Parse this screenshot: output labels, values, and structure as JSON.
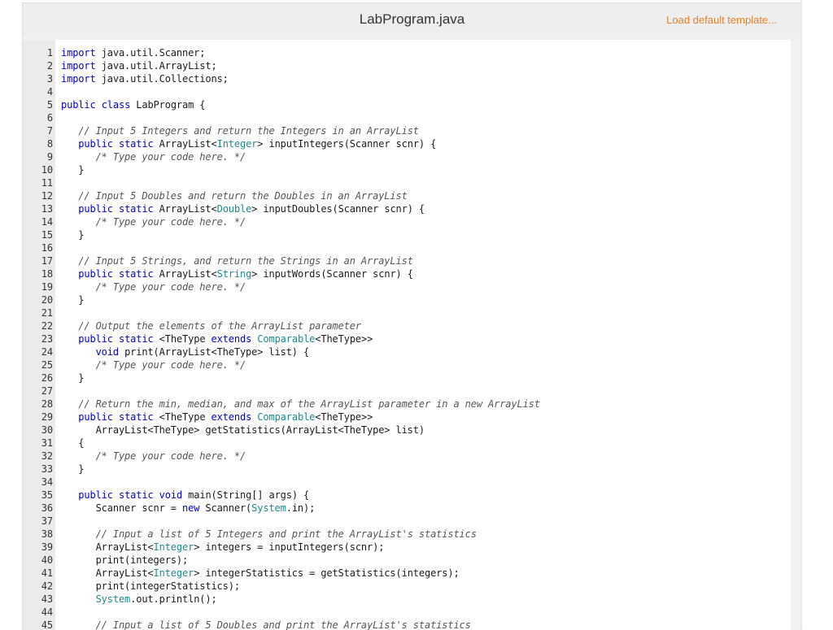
{
  "header": {
    "file_name": "LabProgram.java",
    "load_default_label": "Load default template..."
  },
  "editor": {
    "lines": [
      {
        "num": "1",
        "tokens": [
          {
            "t": "kw",
            "v": "import"
          },
          {
            "t": "",
            "v": " java.util.Scanner;"
          }
        ]
      },
      {
        "num": "2",
        "tokens": [
          {
            "t": "kw",
            "v": "import"
          },
          {
            "t": "",
            "v": " java.util.ArrayList;"
          }
        ]
      },
      {
        "num": "3",
        "tokens": [
          {
            "t": "kw",
            "v": "import"
          },
          {
            "t": "",
            "v": " java.util.Collections;"
          }
        ]
      },
      {
        "num": "4",
        "tokens": []
      },
      {
        "num": "5",
        "tokens": [
          {
            "t": "kw",
            "v": "public"
          },
          {
            "t": "",
            "v": " "
          },
          {
            "t": "kw",
            "v": "class"
          },
          {
            "t": "",
            "v": " LabProgram {"
          }
        ]
      },
      {
        "num": "6",
        "tokens": []
      },
      {
        "num": "7",
        "tokens": [
          {
            "t": "",
            "v": "   "
          },
          {
            "t": "cm",
            "v": "// Input 5 Integers and return the Integers in an ArrayList"
          }
        ]
      },
      {
        "num": "8",
        "tokens": [
          {
            "t": "",
            "v": "   "
          },
          {
            "t": "kw",
            "v": "public"
          },
          {
            "t": "",
            "v": " "
          },
          {
            "t": "kw",
            "v": "static"
          },
          {
            "t": "",
            "v": " ArrayList<"
          },
          {
            "t": "ty",
            "v": "Integer"
          },
          {
            "t": "",
            "v": "> inputIntegers(Scanner scnr) {"
          }
        ]
      },
      {
        "num": "9",
        "tokens": [
          {
            "t": "",
            "v": "      "
          },
          {
            "t": "cm",
            "v": "/* Type your code here. */"
          }
        ]
      },
      {
        "num": "10",
        "tokens": [
          {
            "t": "",
            "v": "   }"
          }
        ]
      },
      {
        "num": "11",
        "tokens": []
      },
      {
        "num": "12",
        "tokens": [
          {
            "t": "",
            "v": "   "
          },
          {
            "t": "cm",
            "v": "// Input 5 Doubles and return the Doubles in an ArrayList"
          }
        ]
      },
      {
        "num": "13",
        "tokens": [
          {
            "t": "",
            "v": "   "
          },
          {
            "t": "kw",
            "v": "public"
          },
          {
            "t": "",
            "v": " "
          },
          {
            "t": "kw",
            "v": "static"
          },
          {
            "t": "",
            "v": " ArrayList<"
          },
          {
            "t": "ty",
            "v": "Double"
          },
          {
            "t": "",
            "v": "> inputDoubles(Scanner scnr) {"
          }
        ]
      },
      {
        "num": "14",
        "tokens": [
          {
            "t": "",
            "v": "      "
          },
          {
            "t": "cm",
            "v": "/* Type your code here. */"
          }
        ]
      },
      {
        "num": "15",
        "tokens": [
          {
            "t": "",
            "v": "   }"
          }
        ]
      },
      {
        "num": "16",
        "tokens": []
      },
      {
        "num": "17",
        "tokens": [
          {
            "t": "",
            "v": "   "
          },
          {
            "t": "cm",
            "v": "// Input 5 Strings, and return the Strings in an ArrayList"
          }
        ]
      },
      {
        "num": "18",
        "tokens": [
          {
            "t": "",
            "v": "   "
          },
          {
            "t": "kw",
            "v": "public"
          },
          {
            "t": "",
            "v": " "
          },
          {
            "t": "kw",
            "v": "static"
          },
          {
            "t": "",
            "v": " ArrayList<"
          },
          {
            "t": "ty",
            "v": "String"
          },
          {
            "t": "",
            "v": "> inputWords(Scanner scnr) {"
          }
        ]
      },
      {
        "num": "19",
        "tokens": [
          {
            "t": "",
            "v": "      "
          },
          {
            "t": "cm",
            "v": "/* Type your code here. */"
          }
        ]
      },
      {
        "num": "20",
        "tokens": [
          {
            "t": "",
            "v": "   }"
          }
        ]
      },
      {
        "num": "21",
        "tokens": []
      },
      {
        "num": "22",
        "tokens": [
          {
            "t": "",
            "v": "   "
          },
          {
            "t": "cm",
            "v": "// Output the elements of the ArrayList parameter"
          }
        ]
      },
      {
        "num": "23",
        "tokens": [
          {
            "t": "",
            "v": "   "
          },
          {
            "t": "kw",
            "v": "public"
          },
          {
            "t": "",
            "v": " "
          },
          {
            "t": "kw",
            "v": "static"
          },
          {
            "t": "",
            "v": " <TheType "
          },
          {
            "t": "kw",
            "v": "extends"
          },
          {
            "t": "",
            "v": " "
          },
          {
            "t": "ty",
            "v": "Comparable"
          },
          {
            "t": "",
            "v": "<TheType>>"
          }
        ]
      },
      {
        "num": "24",
        "tokens": [
          {
            "t": "",
            "v": "      "
          },
          {
            "t": "kw",
            "v": "void"
          },
          {
            "t": "",
            "v": " print(ArrayList<TheType> list) {"
          }
        ]
      },
      {
        "num": "25",
        "tokens": [
          {
            "t": "",
            "v": "      "
          },
          {
            "t": "cm",
            "v": "/* Type your code here. */"
          }
        ]
      },
      {
        "num": "26",
        "tokens": [
          {
            "t": "",
            "v": "   }"
          }
        ]
      },
      {
        "num": "27",
        "tokens": []
      },
      {
        "num": "28",
        "tokens": [
          {
            "t": "",
            "v": "   "
          },
          {
            "t": "cm",
            "v": "// Return the min, median, and max of the ArrayList parameter in a new ArrayList"
          }
        ]
      },
      {
        "num": "29",
        "tokens": [
          {
            "t": "",
            "v": "   "
          },
          {
            "t": "kw",
            "v": "public"
          },
          {
            "t": "",
            "v": " "
          },
          {
            "t": "kw",
            "v": "static"
          },
          {
            "t": "",
            "v": " <TheType "
          },
          {
            "t": "kw",
            "v": "extends"
          },
          {
            "t": "",
            "v": " "
          },
          {
            "t": "ty",
            "v": "Comparable"
          },
          {
            "t": "",
            "v": "<TheType>>"
          }
        ]
      },
      {
        "num": "30",
        "tokens": [
          {
            "t": "",
            "v": "      ArrayList<TheType> getStatistics(ArrayList<TheType> list)"
          }
        ]
      },
      {
        "num": "31",
        "tokens": [
          {
            "t": "",
            "v": "   {"
          }
        ]
      },
      {
        "num": "32",
        "tokens": [
          {
            "t": "",
            "v": "      "
          },
          {
            "t": "cm",
            "v": "/* Type your code here. */"
          }
        ]
      },
      {
        "num": "33",
        "tokens": [
          {
            "t": "",
            "v": "   }"
          }
        ]
      },
      {
        "num": "34",
        "tokens": []
      },
      {
        "num": "35",
        "tokens": [
          {
            "t": "",
            "v": "   "
          },
          {
            "t": "kw",
            "v": "public"
          },
          {
            "t": "",
            "v": " "
          },
          {
            "t": "kw",
            "v": "static"
          },
          {
            "t": "",
            "v": " "
          },
          {
            "t": "kw",
            "v": "void"
          },
          {
            "t": "",
            "v": " main(String[] args) {"
          }
        ]
      },
      {
        "num": "36",
        "tokens": [
          {
            "t": "",
            "v": "      Scanner scnr = "
          },
          {
            "t": "kw",
            "v": "new"
          },
          {
            "t": "",
            "v": " Scanner("
          },
          {
            "t": "ty",
            "v": "System"
          },
          {
            "t": "",
            "v": ".in);"
          }
        ]
      },
      {
        "num": "37",
        "tokens": []
      },
      {
        "num": "38",
        "tokens": [
          {
            "t": "",
            "v": "      "
          },
          {
            "t": "cm",
            "v": "// Input a list of 5 Integers and print the ArrayList's statistics"
          }
        ]
      },
      {
        "num": "39",
        "tokens": [
          {
            "t": "",
            "v": "      ArrayList<"
          },
          {
            "t": "ty",
            "v": "Integer"
          },
          {
            "t": "",
            "v": "> integers = inputIntegers(scnr);"
          }
        ]
      },
      {
        "num": "40",
        "tokens": [
          {
            "t": "",
            "v": "      print(integers);"
          }
        ]
      },
      {
        "num": "41",
        "tokens": [
          {
            "t": "",
            "v": "      ArrayList<"
          },
          {
            "t": "ty",
            "v": "Integer"
          },
          {
            "t": "",
            "v": "> integerStatistics = getStatistics(integers);"
          }
        ]
      },
      {
        "num": "42",
        "tokens": [
          {
            "t": "",
            "v": "      print(integerStatistics);"
          }
        ]
      },
      {
        "num": "43",
        "tokens": [
          {
            "t": "",
            "v": "      "
          },
          {
            "t": "ty",
            "v": "System"
          },
          {
            "t": "",
            "v": ".out.println();"
          }
        ]
      },
      {
        "num": "44",
        "tokens": []
      },
      {
        "num": "45",
        "tokens": [
          {
            "t": "",
            "v": "      "
          },
          {
            "t": "cm",
            "v": "// Input a list of 5 Doubles and print the ArrayList's statistics"
          }
        ]
      }
    ]
  },
  "colors": {
    "keyword": "#0000cc",
    "type": "#1a8a8a",
    "comment": "#555555",
    "link": "#e8812a",
    "gutter": "#ebebeb",
    "header_bg": "#eeeeee"
  }
}
